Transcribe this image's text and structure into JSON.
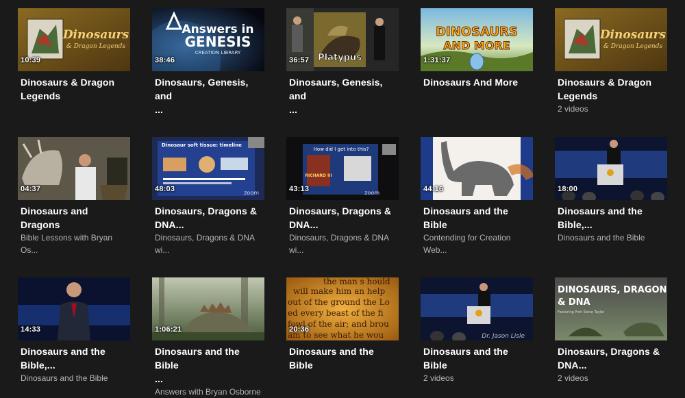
{
  "videos": [
    {
      "duration": "10:39",
      "title_line1": "Dinosaurs & Dragon",
      "title_line2": "Legends",
      "sub1": "",
      "sub2": "",
      "thumb_text": "Dinosaurs",
      "thumb_text2": "& Dragon Legends"
    },
    {
      "duration": "38:46",
      "title_line1": "Dinosaurs, Genesis, and",
      "title_line2": "...",
      "sub1": "",
      "sub2": "",
      "thumb_text": "Answers in",
      "thumb_text2": "GENESIS",
      "thumb_text3": "CREATION LIBRARY"
    },
    {
      "duration": "36:57",
      "title_line1": "Dinosaurs, Genesis, and",
      "title_line2": "...",
      "sub1": "",
      "sub2": "",
      "thumb_text": "Platypus"
    },
    {
      "duration": "1:31:37",
      "title_line1": "Dinosaurs And More",
      "title_line2": "",
      "sub1": "",
      "sub2": "",
      "thumb_text": "DINOSAURS",
      "thumb_text2": "AND MORE"
    },
    {
      "duration": "",
      "title_line1": "Dinosaurs & Dragon",
      "title_line2": "Legends",
      "sub1": "2 videos",
      "sub2": "",
      "thumb_text": "Dinosaurs",
      "thumb_text2": "& Dragon Legends"
    },
    {
      "duration": "04:37",
      "title_line1": "Dinosaurs and Dragons",
      "title_line2": "",
      "sub1": "Bible Lessons with Bryan",
      "sub2": "Os..."
    },
    {
      "duration": "48:03",
      "title_line1": "Dinosaurs, Dragons &",
      "title_line2": "DNA...",
      "sub1": "Dinosaurs, Dragons & DNA",
      "sub2": "wi...",
      "thumb_text": "Dinosaur soft tissue: timeline",
      "thumb_text2": "zoom"
    },
    {
      "duration": "43:13",
      "title_line1": "Dinosaurs, Dragons &",
      "title_line2": "DNA...",
      "sub1": "Dinosaurs, Dragons & DNA",
      "sub2": "wi...",
      "thumb_text": "How did I get into this?",
      "thumb_text2": "zoom",
      "thumb_text3": "RICHARD III"
    },
    {
      "duration": "44:16",
      "title_line1": "Dinosaurs and the Bible",
      "title_line2": "",
      "sub1": "Contending for Creation",
      "sub2": "Web..."
    },
    {
      "duration": "18:00",
      "title_line1": "Dinosaurs and the",
      "title_line2": "Bible,...",
      "sub1": "Dinosaurs and the Bible",
      "sub2": ""
    },
    {
      "duration": "14:33",
      "title_line1": "Dinosaurs and the",
      "title_line2": "Bible,...",
      "sub1": "Dinosaurs and the Bible",
      "sub2": ""
    },
    {
      "duration": "1:06:21",
      "title_line1": "Dinosaurs and the Bible",
      "title_line2": "...",
      "sub1": "Answers with Bryan Osborne",
      "sub2": ""
    },
    {
      "duration": "20:36",
      "title_line1": "Dinosaurs and the Bible",
      "title_line2": "",
      "sub1": "",
      "sub2": "",
      "thumb_text": "the man s hould",
      "thumb_text2": "will make him an help",
      "thumb_text3": "out of the ground the Lo",
      "thumb_text4": "ed every beast of the fi",
      "thumb_text5": "fowl of the air; and brou",
      "thumb_text6": "am to see what he wou"
    },
    {
      "duration": "",
      "title_line1": "Dinosaurs and the Bible",
      "title_line2": "",
      "sub1": "2 videos",
      "sub2": "",
      "thumb_text": "Dr. Jason Lisle"
    },
    {
      "duration": "",
      "title_line1": "Dinosaurs, Dragons &",
      "title_line2": "DNA...",
      "sub1": "2 videos",
      "sub2": "",
      "thumb_text": "DINOSAURS, DRAGONS",
      "thumb_text2": "& DNA",
      "thumb_text3": "Featuring Prof. Steve Taylor"
    }
  ]
}
